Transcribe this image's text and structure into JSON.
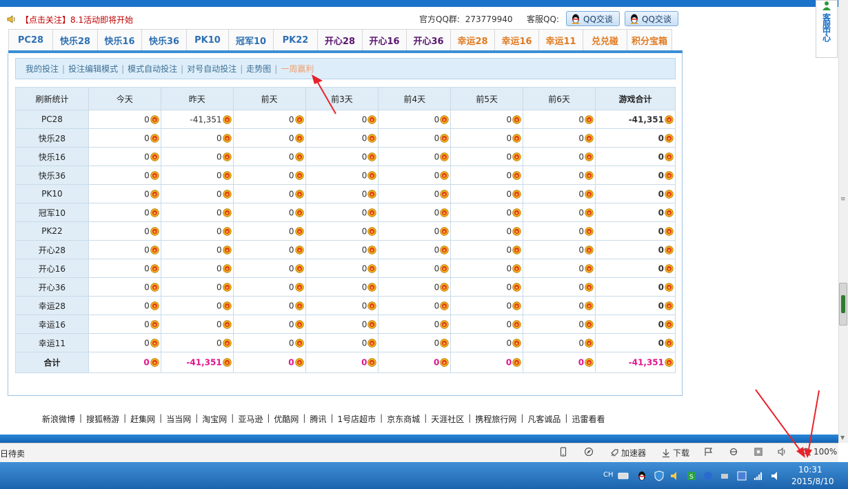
{
  "header": {
    "notice": "【点击关注】8.1活动即将开始",
    "qq_group_label": "官方QQ群:",
    "qq_group_number": "273779940",
    "qq_service_label": "客服QQ:",
    "qq_button_1": "QQ交谈",
    "qq_button_2": "QQ交谈"
  },
  "tabs": [
    {
      "label": "PC28",
      "color": "blue"
    },
    {
      "label": "快乐28",
      "color": "blue"
    },
    {
      "label": "快乐16",
      "color": "blue"
    },
    {
      "label": "快乐36",
      "color": "blue"
    },
    {
      "label": "PK10",
      "color": "blue"
    },
    {
      "label": "冠军10",
      "color": "blue"
    },
    {
      "label": "PK22",
      "color": "blue"
    },
    {
      "label": "开心28",
      "color": "purple"
    },
    {
      "label": "开心16",
      "color": "purple"
    },
    {
      "label": "开心36",
      "color": "purple"
    },
    {
      "label": "幸运28",
      "color": "orange"
    },
    {
      "label": "幸运16",
      "color": "orange"
    },
    {
      "label": "幸运11",
      "color": "orange"
    },
    {
      "label": "兑兑碰",
      "color": "orange"
    },
    {
      "label": "积分宝箱",
      "color": "orange"
    }
  ],
  "subnav": {
    "items": [
      "我的投注",
      "投注编辑模式",
      "模式自动投注",
      "对号自动投注",
      "走势图",
      "一周赢利"
    ],
    "active": "一周赢利"
  },
  "table": {
    "headers": [
      "刷新统计",
      "今天",
      "昨天",
      "前天",
      "前3天",
      "前4天",
      "前5天",
      "前6天",
      "游戏合计"
    ],
    "rows": [
      {
        "name": "PC28",
        "values": [
          "0",
          "-41,351",
          "0",
          "0",
          "0",
          "0",
          "0",
          "-41,351"
        ]
      },
      {
        "name": "快乐28",
        "values": [
          "0",
          "0",
          "0",
          "0",
          "0",
          "0",
          "0",
          "0"
        ]
      },
      {
        "name": "快乐16",
        "values": [
          "0",
          "0",
          "0",
          "0",
          "0",
          "0",
          "0",
          "0"
        ]
      },
      {
        "name": "快乐36",
        "values": [
          "0",
          "0",
          "0",
          "0",
          "0",
          "0",
          "0",
          "0"
        ]
      },
      {
        "name": "PK10",
        "values": [
          "0",
          "0",
          "0",
          "0",
          "0",
          "0",
          "0",
          "0"
        ]
      },
      {
        "name": "冠军10",
        "values": [
          "0",
          "0",
          "0",
          "0",
          "0",
          "0",
          "0",
          "0"
        ]
      },
      {
        "name": "PK22",
        "values": [
          "0",
          "0",
          "0",
          "0",
          "0",
          "0",
          "0",
          "0"
        ]
      },
      {
        "name": "开心28",
        "values": [
          "0",
          "0",
          "0",
          "0",
          "0",
          "0",
          "0",
          "0"
        ]
      },
      {
        "name": "开心16",
        "values": [
          "0",
          "0",
          "0",
          "0",
          "0",
          "0",
          "0",
          "0"
        ]
      },
      {
        "name": "开心36",
        "values": [
          "0",
          "0",
          "0",
          "0",
          "0",
          "0",
          "0",
          "0"
        ]
      },
      {
        "name": "幸运28",
        "values": [
          "0",
          "0",
          "0",
          "0",
          "0",
          "0",
          "0",
          "0"
        ]
      },
      {
        "name": "幸运16",
        "values": [
          "0",
          "0",
          "0",
          "0",
          "0",
          "0",
          "0",
          "0"
        ]
      },
      {
        "name": "幸运11",
        "values": [
          "0",
          "0",
          "0",
          "0",
          "0",
          "0",
          "0",
          "0"
        ]
      }
    ],
    "sum_row": {
      "name": "合计",
      "values": [
        "0",
        "-41,351",
        "0",
        "0",
        "0",
        "0",
        "0",
        "-41,351"
      ]
    }
  },
  "footer_links": [
    "新浪微博",
    "搜狐畅游",
    "赶集网",
    "当当网",
    "淘宝网",
    "亚马逊",
    "优酷网",
    "腾讯",
    "1号店超市",
    "京东商城",
    "天涯社区",
    "携程旅行网",
    "凡客诚品",
    "迅雷看看"
  ],
  "service_float": {
    "label": "客服中心"
  },
  "browser_status": {
    "left_text": "日待卖",
    "accelerator": "加速器",
    "download": "下载",
    "zoom": "100%"
  },
  "taskbar": {
    "lang": "CH",
    "time": "10:31",
    "date": "2015/8/10"
  },
  "colors": {
    "accent_blue": "#3a8ed6",
    "negative_pink": "#e0168b",
    "tab_purple": "#5a1670",
    "tab_orange": "#e07a1f",
    "annotation_red": "#e8222a"
  }
}
